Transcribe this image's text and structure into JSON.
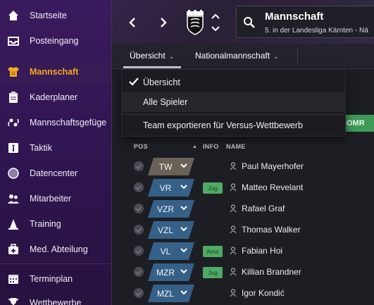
{
  "sidebar": {
    "items": [
      {
        "label": "Startseite",
        "icon": "home-icon"
      },
      {
        "label": "Posteingang",
        "icon": "inbox-icon"
      },
      {
        "label": "Mannschaft",
        "icon": "team-shirt-icon",
        "active": true
      },
      {
        "label": "Kaderplaner",
        "icon": "clipboard-icon"
      },
      {
        "label": "Mannschaftsgefüge",
        "icon": "dynamics-icon"
      },
      {
        "label": "Taktik",
        "icon": "tactics-icon"
      },
      {
        "label": "Datencenter",
        "icon": "data-circle-icon"
      },
      {
        "label": "Mitarbeiter",
        "icon": "staff-icon"
      },
      {
        "label": "Training",
        "icon": "training-icon"
      },
      {
        "label": "Med. Abteilung",
        "icon": "medical-icon"
      },
      {
        "label": "Terminplan",
        "icon": "calendar-icon"
      },
      {
        "label": "Wettbewerbe",
        "icon": "trophy-icon"
      }
    ],
    "active_color": "#f5a623"
  },
  "header": {
    "club_name": "Mannschaft",
    "club_subtitle": "5. in der Landesliga Kärnten - Nä"
  },
  "subtabs": [
    {
      "label": "Übersicht"
    },
    {
      "label": "Nationalmannschaft"
    }
  ],
  "dropdown": {
    "items": [
      {
        "label": "Übersicht",
        "checked": true
      },
      {
        "label": "Alle Spieler"
      },
      {
        "label": "Team exportieren für Versus-Wettbewerb"
      }
    ]
  },
  "toolbar": {
    "omr_label": "OMR"
  },
  "table": {
    "headers": {
      "pos": "POS",
      "info": "INFO",
      "name": "NAME"
    },
    "rows": [
      {
        "pos": "TW",
        "info": "",
        "name": "Paul Mayerhofer",
        "kind": "gk"
      },
      {
        "pos": "VR",
        "info": "Jug",
        "name": "Matteo Revelant",
        "kind": "def"
      },
      {
        "pos": "VZR",
        "info": "",
        "name": "Rafael Graf",
        "kind": "def"
      },
      {
        "pos": "VZL",
        "info": "",
        "name": "Thomas Walker",
        "kind": "def"
      },
      {
        "pos": "VL",
        "info": "Ama",
        "name": "Fabian Hoi",
        "kind": "def"
      },
      {
        "pos": "MZR",
        "info": "Jug",
        "name": "Killian Brandner",
        "kind": "def"
      },
      {
        "pos": "MZL",
        "info": "",
        "name": "Igor Kondić",
        "kind": "def"
      }
    ]
  },
  "colors": {
    "sidebar": "#2f1550",
    "gk_chip": "#6a6257",
    "def_chip": "#356189",
    "info_badge": "#4faa63"
  }
}
